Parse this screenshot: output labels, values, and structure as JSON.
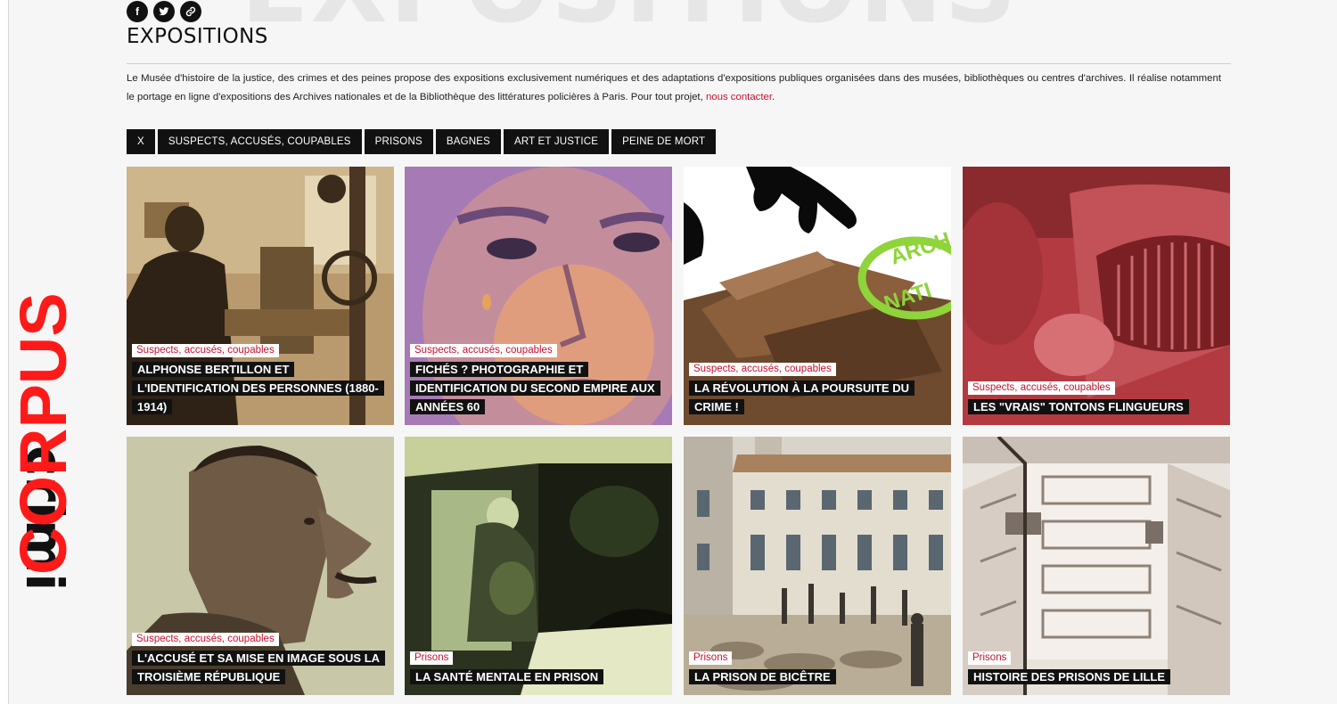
{
  "background_word": "EXPOSITIONS",
  "logo": {
    "text_top": "crimino",
    "text_bottom": "CORPUS",
    "colors": {
      "dark": "#111111",
      "red": "#ff1a1a"
    }
  },
  "social": [
    {
      "icon": "facebook-icon",
      "glyph": "f"
    },
    {
      "icon": "twitter-icon",
      "glyph": "t"
    },
    {
      "icon": "link-icon",
      "glyph": "link"
    }
  ],
  "page_title": "EXPOSITIONS",
  "intro": {
    "text": "Le Musée d'histoire de la justice, des crimes et des peines propose des expositions exclusivement numériques et des adaptations d'expositions publiques organisées dans des musées, bibliothèques ou centres d'archives. Il réalise notamment le portage en ligne d'expositions des Archives nationales et de la Bibliothèque des littératures policières à Paris. Pour tout projet, ",
    "link": "nous contacter",
    "end": "."
  },
  "filters": [
    "X",
    "SUSPECTS, ACCUSÉS, COUPABLES",
    "PRISONS",
    "BAGNES",
    "ART ET JUSTICE",
    "PEINE DE MORT"
  ],
  "colors": {
    "accent": "#c8102e",
    "button": "#111111",
    "background": "#f6f6f6"
  },
  "cards": [
    {
      "tag": "Suspects, accusés, coupables",
      "title": "ALPHONSE BERTILLON ET L'IDENTIFICATION DES PERSONNES (1880-1914)"
    },
    {
      "tag": "Suspects, accusés, coupables",
      "title": "FICHÉS ? PHOTOGRAPHIE ET IDENTIFICATION DU SECOND EMPIRE AUX ANNÉES 60"
    },
    {
      "tag": "Suspects, accusés, coupables",
      "title": "LA RÉVOLUTION À LA POURSUITE DU CRIME !"
    },
    {
      "tag": "Suspects, accusés, coupables",
      "title": "LES \"VRAIS\" TONTONS FLINGUEURS"
    },
    {
      "tag": "Suspects, accusés, coupables",
      "title": "L'ACCUSÉ ET SA MISE EN IMAGE SOUS LA TROISIÈME RÉPUBLIQUE"
    },
    {
      "tag": "Prisons",
      "title": "LA SANTÉ MENTALE EN PRISON"
    },
    {
      "tag": "Prisons",
      "title": "LA PRISON DE BICÊTRE"
    },
    {
      "tag": "Prisons",
      "title": "HISTOIRE DES PRISONS DE LILLE"
    }
  ]
}
